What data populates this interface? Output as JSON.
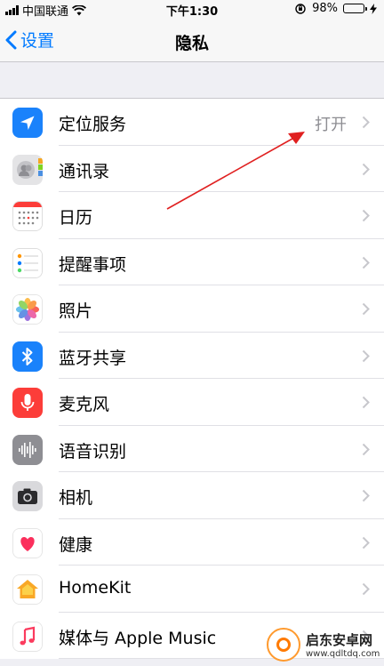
{
  "status_bar": {
    "carrier": "中国联通",
    "time": "下午1:30",
    "battery": "98%",
    "battery_level": 0.98
  },
  "nav": {
    "back_label": "设置",
    "title": "隐私"
  },
  "rows": [
    {
      "label": "定位服务",
      "value": "打开",
      "icon": "location-arrow-icon"
    },
    {
      "label": "通讯录",
      "icon": "contacts-icon"
    },
    {
      "label": "日历",
      "icon": "calendar-icon"
    },
    {
      "label": "提醒事项",
      "icon": "reminders-icon"
    },
    {
      "label": "照片",
      "icon": "photos-icon"
    },
    {
      "label": "蓝牙共享",
      "icon": "bluetooth-icon"
    },
    {
      "label": "麦克风",
      "icon": "microphone-icon"
    },
    {
      "label": "语音识别",
      "icon": "speech-recognition-icon"
    },
    {
      "label": "相机",
      "icon": "camera-icon"
    },
    {
      "label": "健康",
      "icon": "health-heart-icon"
    },
    {
      "label": "HomeKit",
      "icon": "homekit-house-icon"
    },
    {
      "label": "媒体与 Apple Music",
      "icon": "music-note-icon"
    }
  ],
  "watermark": {
    "name": "启东安卓网",
    "url": "www.qdltdq.com"
  },
  "colors": {
    "accent": "#007aff",
    "location": "#1a82fb",
    "bluetooth": "#1a82fb",
    "microphone": "#fc3d39",
    "annotation_arrow": "#e02020"
  }
}
